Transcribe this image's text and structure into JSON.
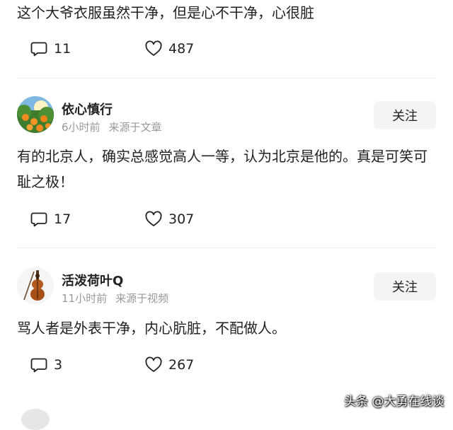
{
  "top_comment": {
    "text": "这个大爷衣服虽然干净，但是心不干净，心很脏",
    "reply_count": "11",
    "like_count": "487"
  },
  "comments": [
    {
      "username": "依心慎行",
      "time": "6小时前",
      "source": "来源于文章",
      "follow_label": "关注",
      "text": "有的北京人，确实总感觉高人一等，认为北京是他的。真是可笑可耻之极！",
      "reply_count": "17",
      "like_count": "307"
    },
    {
      "username": "活泼荷叶Q",
      "time": "11小时前",
      "source": "来源于视频",
      "follow_label": "关注",
      "text": "骂人者是外表干净，内心肮脏，不配做人。",
      "reply_count": "3",
      "like_count": "267"
    }
  ],
  "watermark": "头条 @大勇在线谈",
  "icons": {
    "reply": "speech-bubble-icon",
    "like": "heart-outline-icon"
  },
  "colors": {
    "text": "#222222",
    "meta": "#999999",
    "button_bg": "#f4f4f4",
    "divider": "#eeeeee"
  }
}
